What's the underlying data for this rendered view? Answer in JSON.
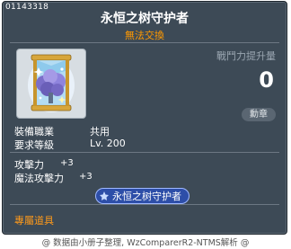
{
  "item": {
    "id": "01143318",
    "name": "永恒之树守护者",
    "trade_note": "無法交換",
    "icon": "spectral-tree-emblem-icon"
  },
  "power": {
    "label": "戰鬥力提升量",
    "value": "0"
  },
  "medal_button": "勳章",
  "requirements": [
    {
      "label": "裝備職業",
      "value": "共用"
    },
    {
      "label": "要求等級",
      "value": "Lv. 200"
    }
  ],
  "stats": [
    {
      "label": "攻擊力",
      "value": "+3"
    },
    {
      "label": "魔法攻擊力",
      "value": "+3"
    }
  ],
  "set_badge": "永恒之树守护者",
  "exclusive_label": "專屬道具",
  "footer": "@ 数据由小册子整理, WzComparerR2-NTMS解析 @",
  "colors": {
    "background": "#3d4a56",
    "trade_note": "#ff9900",
    "exclusive": "#ff9a1a",
    "badge": "#2d4ea8"
  }
}
